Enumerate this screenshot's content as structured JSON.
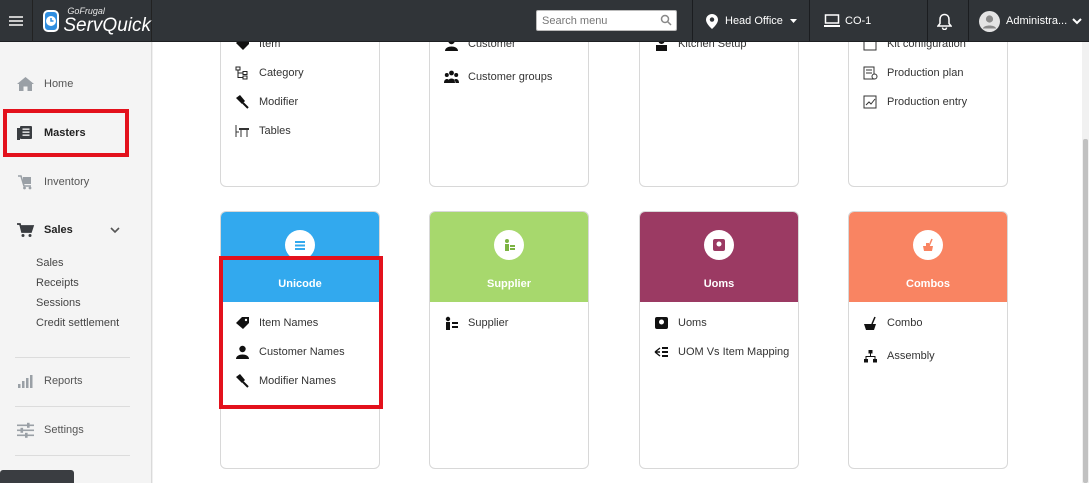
{
  "brand": {
    "small": "GoFrugal",
    "big": "ServQuick"
  },
  "topbar": {
    "search_placeholder": "Search menu",
    "location": "Head Office",
    "counter": "CO-1",
    "user": "Administra..."
  },
  "sidebar": {
    "items": [
      {
        "label": "Home",
        "icon": "home-icon"
      },
      {
        "label": "Masters",
        "icon": "masters-icon"
      },
      {
        "label": "Inventory",
        "icon": "inventory-icon"
      },
      {
        "label": "Sales",
        "icon": "cart-icon"
      },
      {
        "label": "Reports",
        "icon": "reports-icon"
      },
      {
        "label": "Settings",
        "icon": "settings-icon"
      }
    ],
    "sales_sub": [
      "Sales",
      "Receipts",
      "Sessions",
      "Credit settlement"
    ]
  },
  "top_cards": [
    {
      "items": [
        "Item",
        "Category",
        "Modifier",
        "Tables"
      ]
    },
    {
      "items": [
        "Customer",
        "Customer groups"
      ]
    },
    {
      "items": [
        "Kitchen Setup"
      ]
    },
    {
      "items": [
        "Kit configuration",
        "Production plan",
        "Production entry"
      ]
    }
  ],
  "cards": [
    {
      "title": "Unicode",
      "color": "#32a9ee",
      "items": [
        "Item Names",
        "Customer Names",
        "Modifier Names"
      ]
    },
    {
      "title": "Supplier",
      "color": "#a7d86d",
      "items": [
        "Supplier"
      ]
    },
    {
      "title": "Uoms",
      "color": "#9b3a63",
      "items": [
        "Uoms",
        "UOM Vs Item Mapping"
      ]
    },
    {
      "title": "Combos",
      "color": "#f98462",
      "items": [
        "Combo",
        "Assembly"
      ]
    }
  ],
  "colors": {
    "highlight": "#e3111c",
    "topbar": "#303438"
  }
}
